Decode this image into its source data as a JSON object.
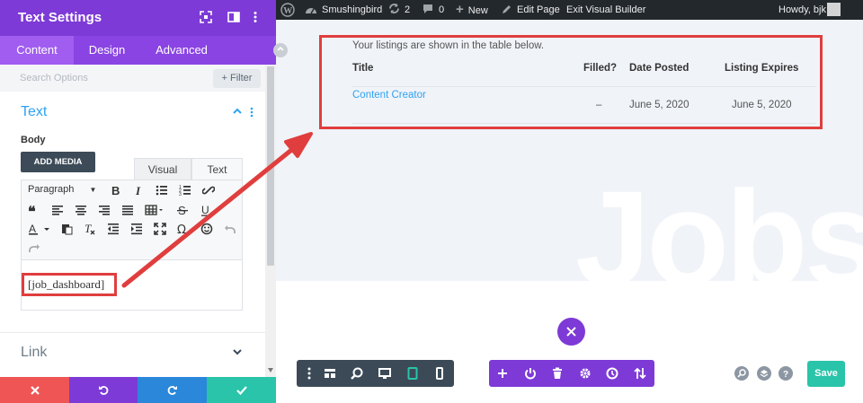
{
  "panel": {
    "title": "Text Settings",
    "tabs": [
      {
        "label": "Content",
        "active": true
      },
      {
        "label": "Design",
        "active": false
      },
      {
        "label": "Advanced",
        "active": false
      }
    ],
    "search_placeholder": "Search Options",
    "filter_label": "Filter",
    "text_section": {
      "title": "Text",
      "field_label": "Body",
      "add_media_label": "ADD MEDIA",
      "editor_tabs": [
        "Visual",
        "Text"
      ],
      "active_editor_tab": "Text",
      "paragraph_select": "Paragraph",
      "content": "[job_dashboard]"
    },
    "link_section": {
      "title": "Link"
    },
    "footer_buttons": [
      "cancel",
      "undo",
      "redo",
      "save"
    ]
  },
  "adminbar": {
    "site_name": "Smushingbird",
    "updates_count": "2",
    "comments_count": "0",
    "new_label": "New",
    "edit_page_label": "Edit Page",
    "exit_label": "Exit Visual Builder",
    "greeting": "Howdy, bjk"
  },
  "listing": {
    "note": "Your listings are shown in the table below.",
    "columns": [
      "Title",
      "Filled?",
      "Date Posted",
      "Listing Expires"
    ],
    "rows": [
      {
        "title": "Content Creator",
        "filled": "–",
        "date_posted": "June 5, 2020",
        "expires": "June 5, 2020"
      }
    ]
  },
  "background_text": "Jobs",
  "bottom": {
    "save_label": "Save"
  },
  "colors": {
    "purple": "#7d3ad6",
    "annotation_red": "#e03e3e",
    "link_blue": "#2ea3f2",
    "save_green": "#29c4a9",
    "footer_red": "#ef5555",
    "footer_purple": "#7d3ad6",
    "footer_blue": "#2b87da",
    "footer_green": "#29c4a9"
  }
}
